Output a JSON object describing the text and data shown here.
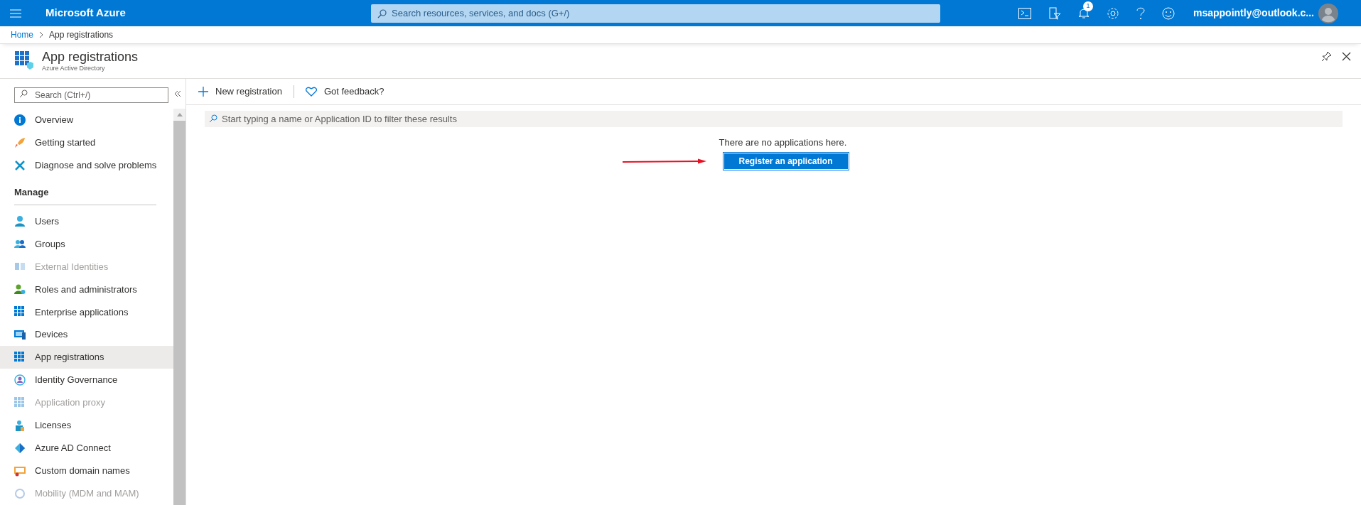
{
  "topbar": {
    "brand": "Microsoft Azure",
    "search": {
      "placeholder": "Search resources, services, and docs (G+/)"
    },
    "notification_count": "1",
    "account": "msappointly@outlook.c..."
  },
  "breadcrumb": [
    "Home",
    "App registrations"
  ],
  "page": {
    "title": "App registrations",
    "subtitle": "Azure Active Directory"
  },
  "sidebar": {
    "search": {
      "placeholder": "Search (Ctrl+/)"
    },
    "items": [
      {
        "label": "Overview",
        "selected": false,
        "disabled": false
      },
      {
        "label": "Getting started",
        "selected": false,
        "disabled": false
      },
      {
        "label": "Diagnose and solve problems",
        "selected": false,
        "disabled": false
      }
    ],
    "section": "Manage",
    "manage_items": [
      {
        "label": "Users",
        "selected": false,
        "disabled": false
      },
      {
        "label": "Groups",
        "selected": false,
        "disabled": false
      },
      {
        "label": "External Identities",
        "selected": false,
        "disabled": true
      },
      {
        "label": "Roles and administrators",
        "selected": false,
        "disabled": false
      },
      {
        "label": "Enterprise applications",
        "selected": false,
        "disabled": false
      },
      {
        "label": "Devices",
        "selected": false,
        "disabled": false
      },
      {
        "label": "App registrations",
        "selected": true,
        "disabled": false
      },
      {
        "label": "Identity Governance",
        "selected": false,
        "disabled": false
      },
      {
        "label": "Application proxy",
        "selected": false,
        "disabled": true
      },
      {
        "label": "Licenses",
        "selected": false,
        "disabled": false
      },
      {
        "label": "Azure AD Connect",
        "selected": false,
        "disabled": false
      },
      {
        "label": "Custom domain names",
        "selected": false,
        "disabled": false
      },
      {
        "label": "Mobility (MDM and MAM)",
        "selected": false,
        "disabled": true
      }
    ]
  },
  "toolbar": [
    "New registration",
    "Got feedback?"
  ],
  "filter": {
    "placeholder": "Start typing a name or Application ID to filter these results"
  },
  "empty_message": "There are no applications here.",
  "register_button": "Register an application"
}
